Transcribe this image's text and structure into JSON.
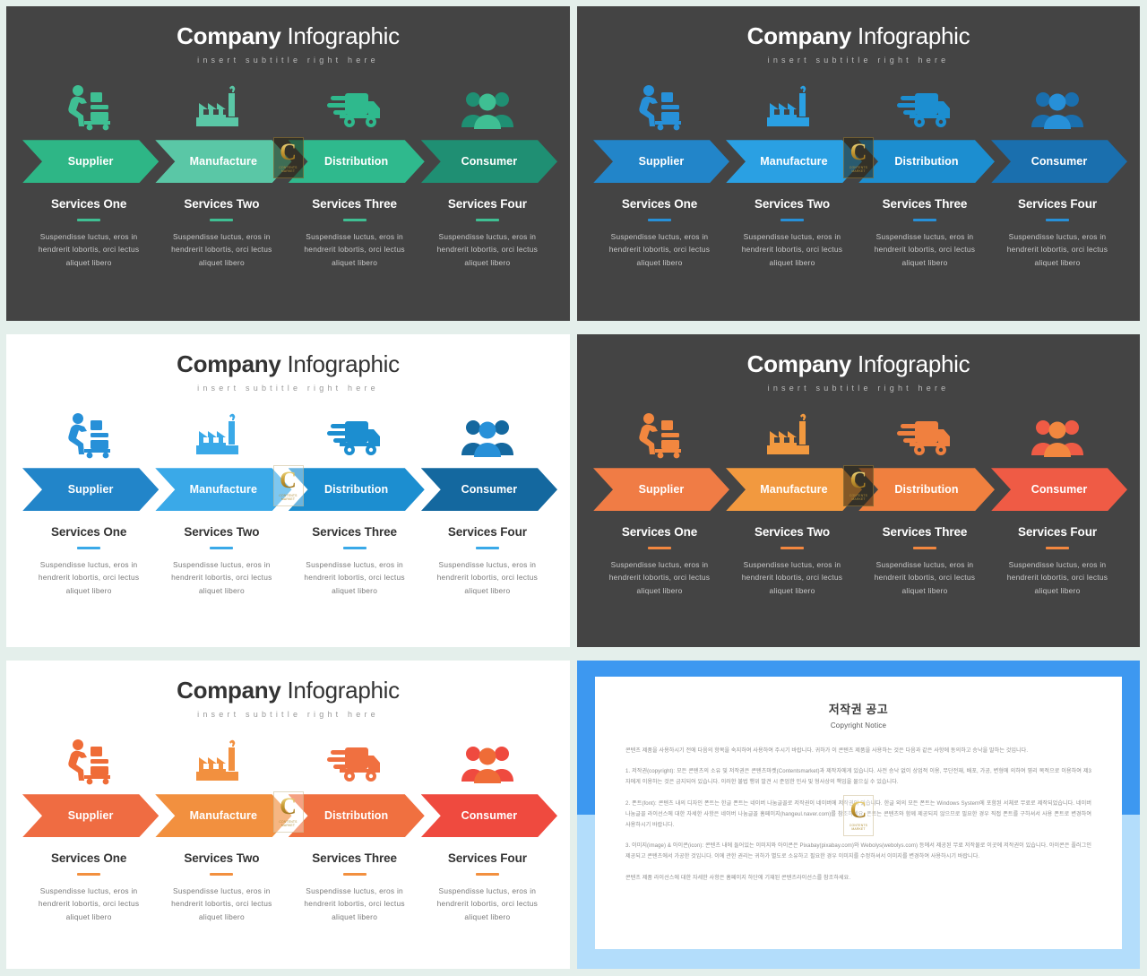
{
  "common": {
    "title_bold": "Company",
    "title_light": " Infographic",
    "subtitle": "insert subtitle right here",
    "steps": [
      "Supplier",
      "Manufacture",
      "Distribution",
      "Consumer"
    ],
    "icons": [
      "worker-cart-icon",
      "factory-icon",
      "delivery-truck-icon",
      "people-group-icon"
    ],
    "services": [
      {
        "heading": "Services One",
        "body": "Suspendisse luctus, eros in hendrerit lobortis, orci lectus aliquet libero"
      },
      {
        "heading": "Services Two",
        "body": "Suspendisse luctus, eros in hendrerit lobortis, orci lectus aliquet libero"
      },
      {
        "heading": "Services Three",
        "body": "Suspendisse luctus, eros in hendrerit lobortis, orci lectus aliquet libero"
      },
      {
        "heading": "Services Four",
        "body": "Suspendisse luctus, eros in hendrerit lobortis, orci lectus aliquet libero"
      }
    ],
    "watermark": {
      "letter": "C",
      "caption": "CONTENTS\nMARKET"
    }
  },
  "slides": [
    {
      "id": "slide-teal-dark",
      "theme": "dark",
      "background": "#444444",
      "icon_color": "#3fbf93",
      "chevrons": [
        "#2eb686",
        "#5ac7a6",
        "#2fb98d",
        "#1f8f73"
      ],
      "rule_color": "#3fbf93"
    },
    {
      "id": "slide-blue-dark",
      "theme": "dark",
      "background": "#444444",
      "icon_color": "#2790d8",
      "chevrons": [
        "#2285c9",
        "#2aa0e3",
        "#1c8ed0",
        "#1a6fae"
      ],
      "rule_color": "#2790d8"
    },
    {
      "id": "slide-blue-light",
      "theme": "light",
      "background": "#ffffff",
      "icon_color": "#2790d8",
      "chevrons": [
        "#2285c9",
        "#3aa9e8",
        "#1c8ed0",
        "#14689f"
      ],
      "rule_color": "#3aa9e8"
    },
    {
      "id": "slide-orange-dark",
      "theme": "dark",
      "background": "#444444",
      "icon_color": "#f2873f",
      "chevrons": [
        "#f07c45",
        "#f2993f",
        "#f0803f",
        "#ef5b45"
      ],
      "rule_color": "#f2873f"
    },
    {
      "id": "slide-orange-light",
      "theme": "light",
      "background": "#ffffff",
      "icon_color": "#ef6c37",
      "chevrons": [
        "#ef6c42",
        "#f2903f",
        "#f07040",
        "#ef4a3f"
      ],
      "rule_color": "#f2903f"
    }
  ],
  "copyright": {
    "title": "저작권 공고",
    "subtitle": "Copyright Notice",
    "paragraphs": [
      "콘텐츠 제품을 사용하시기 전에 다음의 항목을 숙지하여 사용하여 주시기 바랍니다. 귀하가 이 콘텐츠 제품을 사용하는 것은 다음과 같은 사항에 동의하고 승낙을 말하는 것입니다.",
      "1. 저작권(copyright): 모든 콘텐츠의 소유 및 저작권은 콘텐츠마켓(Contentsmarket)과 제작자에게 있습니다. 사전 승낙 없이 상업적 이용, 무단전재, 배포, 가공, 변형에 의하여 영리 목적으로 이용하여 제3자에게 이용하는 것은 금지되어 있습니다. 이러한 불법 행위 발견 시 준엄한 민사 및 형사상의 책임을 물으실 수 있습니다.",
      "2. 폰트(font): 콘텐츠 내의 디자인 폰트는 한글 폰트는 네이버 나눔글꼴로 저작권이 네이버에 저작권이 있습니다. 한글 외의 모든 폰트는 Windows System에 포함된 서체로 무료로 제작되었습니다. 네이버 나눔글꼴 라이선스에 대한 자세한 사항은 네이버 나눔글꼴 홈페이지(hangeul.naver.com)를 참조하세요. 폰트는 콘텐츠와 함께 제공되지 않으므로 필요한 경우 직접 폰트를 구하셔서 사용 폰트로 변경하여 사용하시기 바랍니다.",
      "3. 이미지(image) & 아이콘(icon): 콘텐츠 내에 들어있는 이미지와 아이콘은 Pixabay(pixabay.com)와 Webolys(webolys.com) 등에서 제공된 무료 저작물로 이곳에 저작권이 있습니다. 아이콘은 플러그인 제공되고 콘텐츠에서 가공한 것입니다. 이에 관한 권리는 귀하가 별도로 소유하고 필요한 경우 이미지를 수정하셔서 이미지를 변경하여 사용하시기 바랍니다.",
      "콘텐츠 제품 라이선스에 대한 자세한 사항은 홈페이지 하단에 기재된 콘텐츠라이선스를 참조하세요."
    ]
  }
}
